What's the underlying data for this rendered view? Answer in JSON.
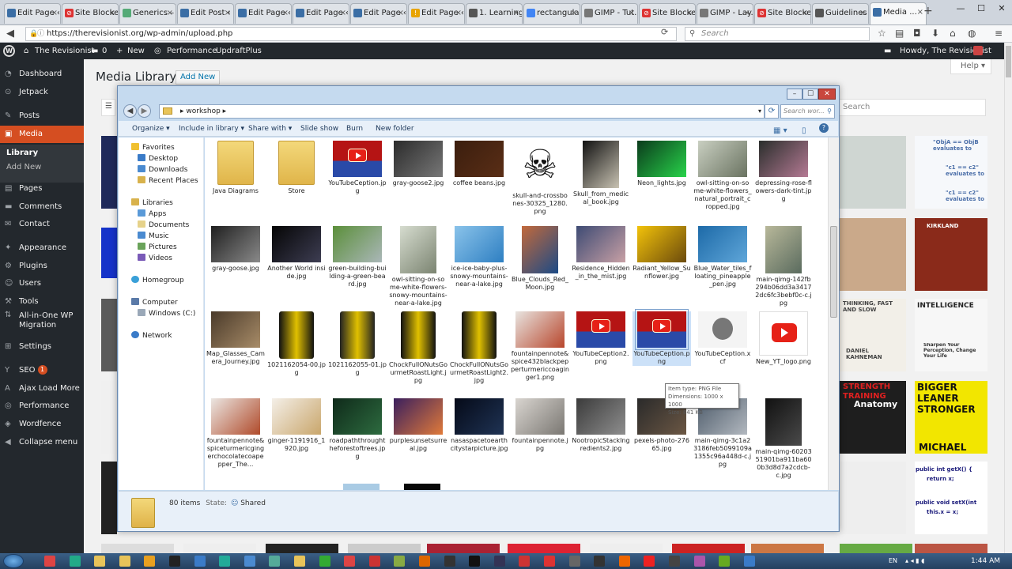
{
  "browser": {
    "tabs": [
      {
        "label": "Edit Page ‹",
        "icon": "wp",
        "color": "#3b6ea5"
      },
      {
        "label": "Site Blocked",
        "icon": "block",
        "color": "#d33"
      },
      {
        "label": "Generics –",
        "icon": "doc",
        "color": "#5a7"
      },
      {
        "label": "Edit Post ‹",
        "icon": "wp",
        "color": "#3b6ea5"
      },
      {
        "label": "Edit Page ‹",
        "icon": "wp",
        "color": "#3b6ea5"
      },
      {
        "label": "Edit Page ‹",
        "icon": "wp",
        "color": "#3b6ea5"
      },
      {
        "label": "Edit Page ‹",
        "icon": "wp",
        "color": "#3b6ea5"
      },
      {
        "label": "Edit Page ‹",
        "icon": "warn",
        "color": "#e8a400"
      },
      {
        "label": "1. Learning...",
        "icon": "doc",
        "color": "#555"
      },
      {
        "label": "rectangula...",
        "icon": "google",
        "color": "#4285f4"
      },
      {
        "label": "GIMP - Tut...",
        "icon": "gimp",
        "color": "#777"
      },
      {
        "label": "Site Blocked",
        "icon": "block",
        "color": "#d33"
      },
      {
        "label": "GIMP - Lay...",
        "icon": "gimp",
        "color": "#777"
      },
      {
        "label": "Site Blocked",
        "icon": "block",
        "color": "#d33"
      },
      {
        "label": "Guidelines ...",
        "icon": "doc",
        "color": "#555"
      },
      {
        "label": "Media ...",
        "icon": "wp",
        "color": "#3b6ea5"
      }
    ],
    "new_tab": "+",
    "url": "https://therevisionist.org/wp-admin/upload.php",
    "search_placeholder": "Search"
  },
  "adminbar": {
    "site_name": "The Revisionist",
    "comments": "0",
    "new": "New",
    "performance": "Performance",
    "updraft": "UpdraftPlus",
    "howdy": "Howdy, The Revisionist"
  },
  "sidebar": {
    "items": [
      {
        "label": "Dashboard",
        "icon": "dashboard-icon",
        "glyph": "◔"
      },
      {
        "label": "Jetpack",
        "icon": "jetpack-icon",
        "glyph": "⊙"
      },
      {
        "label": "Posts",
        "icon": "posts-icon",
        "glyph": "✎"
      },
      {
        "label": "Media",
        "icon": "media-icon",
        "glyph": "▣"
      },
      {
        "label": "Pages",
        "icon": "pages-icon",
        "glyph": "▤"
      },
      {
        "label": "Comments",
        "icon": "comments-icon",
        "glyph": "▬"
      },
      {
        "label": "Contact",
        "icon": "contact-icon",
        "glyph": "✉"
      },
      {
        "label": "Appearance",
        "icon": "appearance-icon",
        "glyph": "✦"
      },
      {
        "label": "Plugins",
        "icon": "plugins-icon",
        "glyph": "⚙"
      },
      {
        "label": "Users",
        "icon": "users-icon",
        "glyph": "☺"
      },
      {
        "label": "Tools",
        "icon": "tools-icon",
        "glyph": "⚒"
      },
      {
        "label": "All-in-One WP Migration",
        "icon": "migration-icon",
        "glyph": "⇅"
      },
      {
        "label": "Settings",
        "icon": "settings-icon",
        "glyph": "⊞"
      },
      {
        "label": "SEO",
        "icon": "seo-icon",
        "glyph": "Y",
        "badge": "1"
      },
      {
        "label": "Ajax Load More",
        "icon": "ajax-icon",
        "glyph": "A"
      },
      {
        "label": "Performance",
        "icon": "performance-icon",
        "glyph": "◎"
      },
      {
        "label": "Wordfence",
        "icon": "wordfence-icon",
        "glyph": "◈"
      },
      {
        "label": "Collapse menu",
        "icon": "collapse-icon",
        "glyph": "◀"
      }
    ],
    "submenu": [
      "Library",
      "Add New"
    ]
  },
  "content": {
    "title": "Media Library",
    "add_new": "Add New",
    "help": "Help ▾",
    "search": "Search",
    "tile_texts": {
      "objA": "\"ObjA == ObjB evaluates to",
      "c1a": "\"c1 == c2\" evaluates to",
      "c1b": "\"c1 == c2\" evaluates to",
      "kirkland": "KIRKLAND",
      "thinking": "THINKING, FAST AND SLOW",
      "kahneman": "DANIEL KAHNEMAN",
      "intelligence": "INTELLIGENCE",
      "sharpen": "Sharpen Your Perception, Change Your Life",
      "strength": "STRENGTH TRAINING",
      "anatomy": "Anatomy",
      "bigger": "BIGGER LEANER STRONGER",
      "michael": "MICHAEL",
      "code1": "public int getX() {",
      "code2": "return x;",
      "code3": "public void setX(int",
      "code4": "this.x = x;"
    }
  },
  "explorer": {
    "path": "workshop",
    "search_placeholder": "Search wor...",
    "toolbar": {
      "organize": "Organize ▾",
      "include": "Include in library ▾",
      "share": "Share with ▾",
      "slideshow": "Slide show",
      "burn": "Burn",
      "newfolder": "New folder"
    },
    "nav": {
      "favorites": "Favorites",
      "desktop": "Desktop",
      "downloads": "Downloads",
      "recent": "Recent Places",
      "libraries": "Libraries",
      "apps": "Apps",
      "documents": "Documents",
      "music": "Music",
      "pictures": "Pictures",
      "videos": "Videos",
      "homegroup": "Homegroup",
      "computer": "Computer",
      "windows": "Windows (C:)",
      "network": "Network"
    },
    "files": [
      {
        "name": "Java Diagrams",
        "kind": "folder"
      },
      {
        "name": "Store",
        "kind": "folder"
      },
      {
        "name": "YouTubeCeption.jpg",
        "kind": "yt",
        "colors": [
          "#b51414",
          "#2a4aa8"
        ]
      },
      {
        "name": "gray-goose2.jpg",
        "kind": "img",
        "colors": [
          "#2b2b2b",
          "#777"
        ]
      },
      {
        "name": "coffee beans.jpg",
        "kind": "img",
        "colors": [
          "#3b1e0e",
          "#5a2e16"
        ]
      },
      {
        "name": "skull-and-crossbones-30325_1280.png",
        "kind": "skull",
        "colors": [
          "#fff",
          "#111"
        ]
      },
      {
        "name": "Skull_from_medical_book.jpg",
        "kind": "img",
        "colors": [
          "#111",
          "#c9c3b3"
        ]
      },
      {
        "name": "Neon_lights.jpg",
        "kind": "img",
        "colors": [
          "#0b3b1c",
          "#28d34a"
        ]
      },
      {
        "name": "owl-sitting-on-some-white-flowers_natural_portrait_cropped.jpg",
        "kind": "img",
        "colors": [
          "#c9cfc1",
          "#6a7361"
        ]
      },
      {
        "name": "depressing-rose-flowers-dark-tint.jpg",
        "kind": "img",
        "colors": [
          "#2a2e2c",
          "#b57a94"
        ]
      },
      {
        "name": "gray-goose.jpg",
        "kind": "img",
        "colors": [
          "#1f1f1f",
          "#8a8a8a"
        ]
      },
      {
        "name": "Another World inside.jpg",
        "kind": "img",
        "colors": [
          "#050505",
          "#3d3d52"
        ]
      },
      {
        "name": "green-building-building-a-green-beard.jpg",
        "kind": "img",
        "colors": [
          "#5b8f3a",
          "#aab7b8"
        ]
      },
      {
        "name": "owl-sitting-on-some-white-flowers-snowy-mountains-near-a-lake.jpg",
        "kind": "img",
        "colors": [
          "#d6dccf",
          "#7b8471"
        ]
      },
      {
        "name": "ice-ice-baby-plus-snowy-mountains-near-a-lake.jpg",
        "kind": "img",
        "colors": [
          "#8ac3ea",
          "#2e7fc2"
        ]
      },
      {
        "name": "Blue_Clouds_Red_Moon.jpg",
        "kind": "img",
        "colors": [
          "#c2693b",
          "#1b4a86"
        ]
      },
      {
        "name": "Residence_Hidden_in_the_mist.jpg",
        "kind": "img",
        "colors": [
          "#3e4b74",
          "#c8a0a5"
        ]
      },
      {
        "name": "Radiant_Yellow_Sunflower.jpg",
        "kind": "img",
        "colors": [
          "#f2c20a",
          "#6b4a0c"
        ]
      },
      {
        "name": "Blue_Water_tiles_floating_pineapple_pen.jpg",
        "kind": "img",
        "colors": [
          "#1d6aa8",
          "#5fa6d9"
        ]
      },
      {
        "name": "main-qimg-142fb294b06dd3a34172dc6fc3bebf0c-c.jpg",
        "kind": "img",
        "colors": [
          "#b8b89a",
          "#5a6b5e"
        ]
      },
      {
        "name": "Map_Glasses_Camera_Journey.jpg",
        "kind": "img",
        "colors": [
          "#4a3a2a",
          "#a88c68"
        ]
      },
      {
        "name": "1021162054-00.jpg",
        "kind": "can",
        "colors": [
          "#111",
          "#e0c000"
        ]
      },
      {
        "name": "1021162055-01.jpg",
        "kind": "can",
        "colors": [
          "#222",
          "#e0c000"
        ]
      },
      {
        "name": "ChockFullONutsGourmetRoastLight.jpg",
        "kind": "can",
        "colors": [
          "#111",
          "#e0c000"
        ]
      },
      {
        "name": "ChockFullONutsGourmetRoastLight2.jpg",
        "kind": "can",
        "colors": [
          "#111",
          "#e0c000"
        ]
      },
      {
        "name": "fountainpennote&spice432blackpepperturmericcoaginger1.png",
        "kind": "img",
        "colors": [
          "#e8e4e0",
          "#b8462c"
        ]
      },
      {
        "name": "YouTubeCeption2.png",
        "kind": "yt",
        "colors": [
          "#b51414",
          "#2a4aa8"
        ]
      },
      {
        "name": "YouTubeCeption.png",
        "kind": "yt",
        "colors": [
          "#b51414",
          "#2a4aa8"
        ],
        "selected": true
      },
      {
        "name": "YouTubeCeption.xcf",
        "kind": "gimp",
        "colors": [
          "#f4f4f4",
          "#777"
        ]
      },
      {
        "name": "New_YT_logo.png",
        "kind": "ytlogo",
        "colors": [
          "#fff",
          "#e62117"
        ]
      },
      {
        "name": "fountainpennote&spiceturmericgingerchocolatecoapepper_The...",
        "kind": "img",
        "colors": [
          "#ebe6e2",
          "#b04a2a"
        ]
      },
      {
        "name": "ginger-1191916_1920.jpg",
        "kind": "img",
        "colors": [
          "#f4efe8",
          "#c9a66b"
        ]
      },
      {
        "name": "roadpaththroughtheforestoftrees.jpg",
        "kind": "img",
        "colors": [
          "#0f2a1a",
          "#2d6b3f"
        ]
      },
      {
        "name": "purplesunsetsurreal.jpg",
        "kind": "img",
        "colors": [
          "#3a1f5e",
          "#e07a3a"
        ]
      },
      {
        "name": "nasaspacetoearthcitystarpicture.jpg",
        "kind": "img",
        "colors": [
          "#050a18",
          "#1f3354"
        ]
      },
      {
        "name": "fountainpennote.jpg",
        "kind": "img",
        "colors": [
          "#d9d5d0",
          "#7a7772"
        ]
      },
      {
        "name": "NootropicStackIngredients2.jpg",
        "kind": "img",
        "colors": [
          "#3b3b3b",
          "#8e8e8e"
        ]
      },
      {
        "name": "pexels-photo-27665.jpg",
        "kind": "img",
        "colors": [
          "#2a2a2a",
          "#6b5744"
        ]
      },
      {
        "name": "main-qimg-3c1a23186feb5099109a1355c96a448d-c.jpg",
        "kind": "img",
        "colors": [
          "#4e5c6b",
          "#b2b8bf"
        ]
      },
      {
        "name": "main-qimg-6020351901ba911ba600b3d8d7a2cdcb-c.jpg",
        "kind": "img",
        "colors": [
          "#111",
          "#4a4a4a"
        ]
      }
    ],
    "tooltip": {
      "type": "Item type: PNG File",
      "dims": "Dimensions: 1000 x 1000",
      "size": "Size: 841 KB"
    },
    "status": {
      "count": "80 items",
      "state_label": "State:",
      "state": "Shared"
    }
  },
  "taskbar": {
    "lang": "EN",
    "time": "1:44 AM"
  }
}
